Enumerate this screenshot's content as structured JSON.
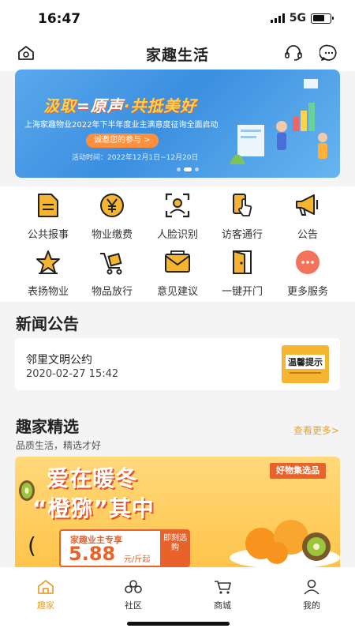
{
  "status": {
    "time": "16:47",
    "network": "5G"
  },
  "nav": {
    "title": "家趣生活",
    "left_icon": "home-icon",
    "right_icons": [
      "headset-icon",
      "chat-icon"
    ]
  },
  "banner": {
    "headline_part1": "汲取",
    "headline_mid": "=原声",
    "headline_part2": "·共抵美好",
    "subtitle": "上海家趣物业2022年下半年度业主满意度征询全面启动",
    "button": "诚邀您的参与 >",
    "date": "活动时间：2022年12月1日~12月20日"
  },
  "services": [
    {
      "label": "公共报事",
      "icon": "document-icon"
    },
    {
      "label": "物业缴费",
      "icon": "yen-coin-icon"
    },
    {
      "label": "人脸识别",
      "icon": "face-scan-icon"
    },
    {
      "label": "访客通行",
      "icon": "phone-tap-icon"
    },
    {
      "label": "公告",
      "icon": "megaphone-icon"
    },
    {
      "label": "表扬物业",
      "icon": "star-icon"
    },
    {
      "label": "物品放行",
      "icon": "cart-icon"
    },
    {
      "label": "意见建议",
      "icon": "envelope-icon"
    },
    {
      "label": "一键开门",
      "icon": "door-icon"
    },
    {
      "label": "更多服务",
      "icon": "more-icon"
    }
  ],
  "news": {
    "section_title": "新闻公告",
    "items": [
      {
        "title": "邻里文明公约",
        "time": "2020-02-27 15:42",
        "thumb_text": "温馨提示"
      }
    ]
  },
  "featured": {
    "section_title": "趣家精选",
    "subtitle": "品质生活，精选才好",
    "more_link": "查看更多>",
    "promo": {
      "headline1": "爱在暖冬",
      "headline2": "“橙猕”其中",
      "tag": "好物集选品",
      "price_label": "家趣业主专享",
      "price": "5.88",
      "price_unit": "元/斤起",
      "buy_button": "即刻选购",
      "paren": "("
    }
  },
  "tabs": [
    {
      "label": "趣家",
      "icon": "home-tab-icon",
      "active": true
    },
    {
      "label": "社区",
      "icon": "community-icon",
      "active": false
    },
    {
      "label": "商城",
      "icon": "shop-cart-icon",
      "active": false
    },
    {
      "label": "我的",
      "icon": "user-icon",
      "active": false
    }
  ],
  "colors": {
    "accent": "#e9a233",
    "icon_fill": "#f6b530",
    "banner_blue": "#3b8fe0",
    "promo_orange": "#e8632c"
  }
}
